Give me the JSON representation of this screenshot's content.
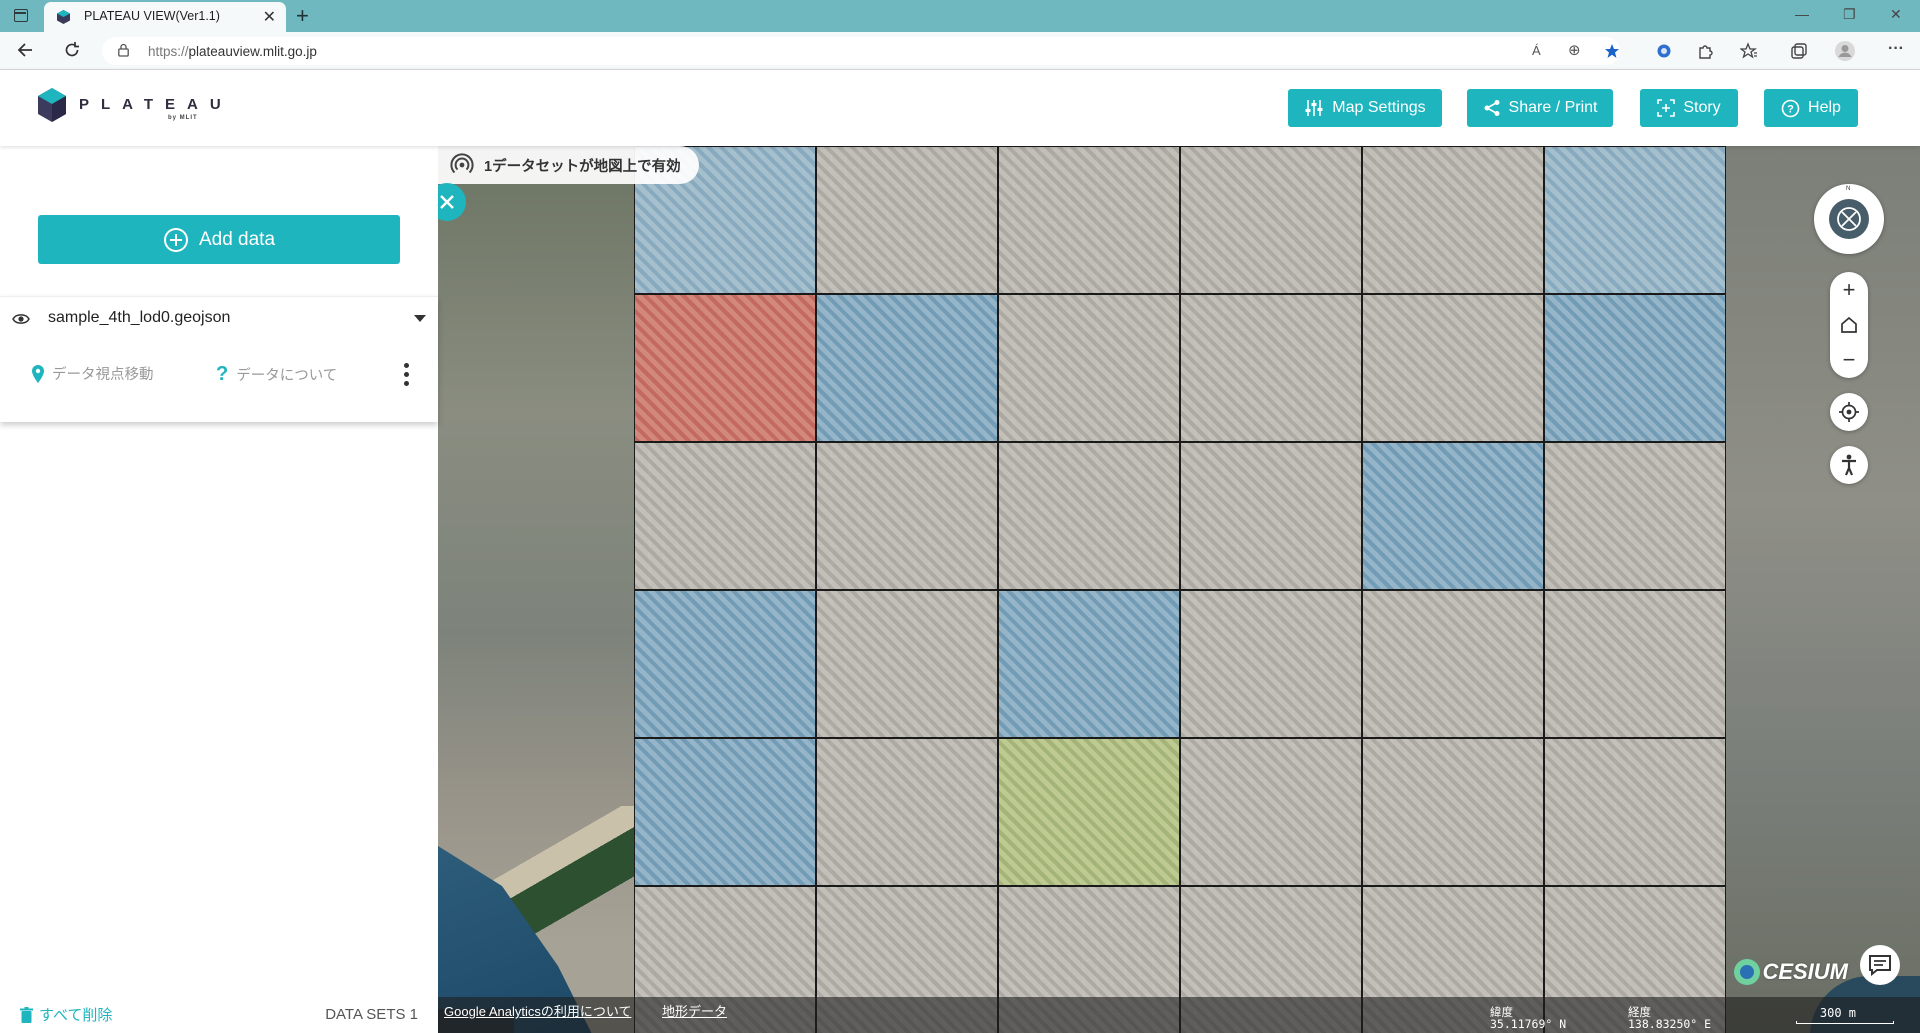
{
  "browser": {
    "tab_title": "PLATEAU VIEW(Ver1.1)",
    "url_scheme": "https://",
    "url_host": "plateauview.mlit.go.jp",
    "new_tab": "+",
    "tab_close": "✕",
    "win_min": "—",
    "win_max": "❐",
    "win_close": "✕",
    "read_aloud": "Á",
    "zoom_icon": "⊕"
  },
  "header": {
    "logo_text": "PLATEAU",
    "logo_sub": "by MLIT",
    "buttons": {
      "map_settings": "Map Settings",
      "share_print": "Share / Print",
      "story": "Story",
      "help": "Help"
    }
  },
  "sidebar": {
    "add_data": "Add data",
    "dataset": {
      "name": "sample_4th_lod0.geojson",
      "move_view": "データ視点移動",
      "about": "データについて"
    },
    "delete_all": "すべて削除",
    "dataset_count": "DATA SETS 1"
  },
  "map": {
    "active_datasets": "1データセットが地図上で有効",
    "compass_n": "N",
    "zoom_in": "+",
    "zoom_out": "−",
    "footer": {
      "analytics_link": "Google Analyticsの利用について",
      "terrain_link": "地形データ",
      "lat_label": "緯度",
      "lat_value": "35.11769° N",
      "lon_label": "経度",
      "lon_value": "138.83250° E",
      "scale": "300 m"
    },
    "cesium": "CESIUM"
  },
  "colors": {
    "accent": "#1fb5be",
    "tabbar": "#6fb8c0"
  },
  "grid_colors": [
    [
      "c-lblue",
      "c-gray",
      "c-gray",
      "c-gray",
      "c-gray",
      "c-lblue"
    ],
    [
      "c-red",
      "c-blue",
      "c-gray",
      "c-gray",
      "c-gray",
      "c-blue"
    ],
    [
      "c-gray",
      "c-gray",
      "c-gray",
      "c-gray",
      "c-blue",
      "c-gray"
    ],
    [
      "c-blue",
      "c-gray",
      "c-blue",
      "c-gray",
      "c-gray",
      "c-gray"
    ],
    [
      "c-blue",
      "c-gray",
      "c-green",
      "c-gray",
      "c-gray",
      "c-gray"
    ],
    [
      "c-gray",
      "c-gray",
      "c-gray",
      "c-gray",
      "c-gray",
      "c-gray"
    ]
  ]
}
